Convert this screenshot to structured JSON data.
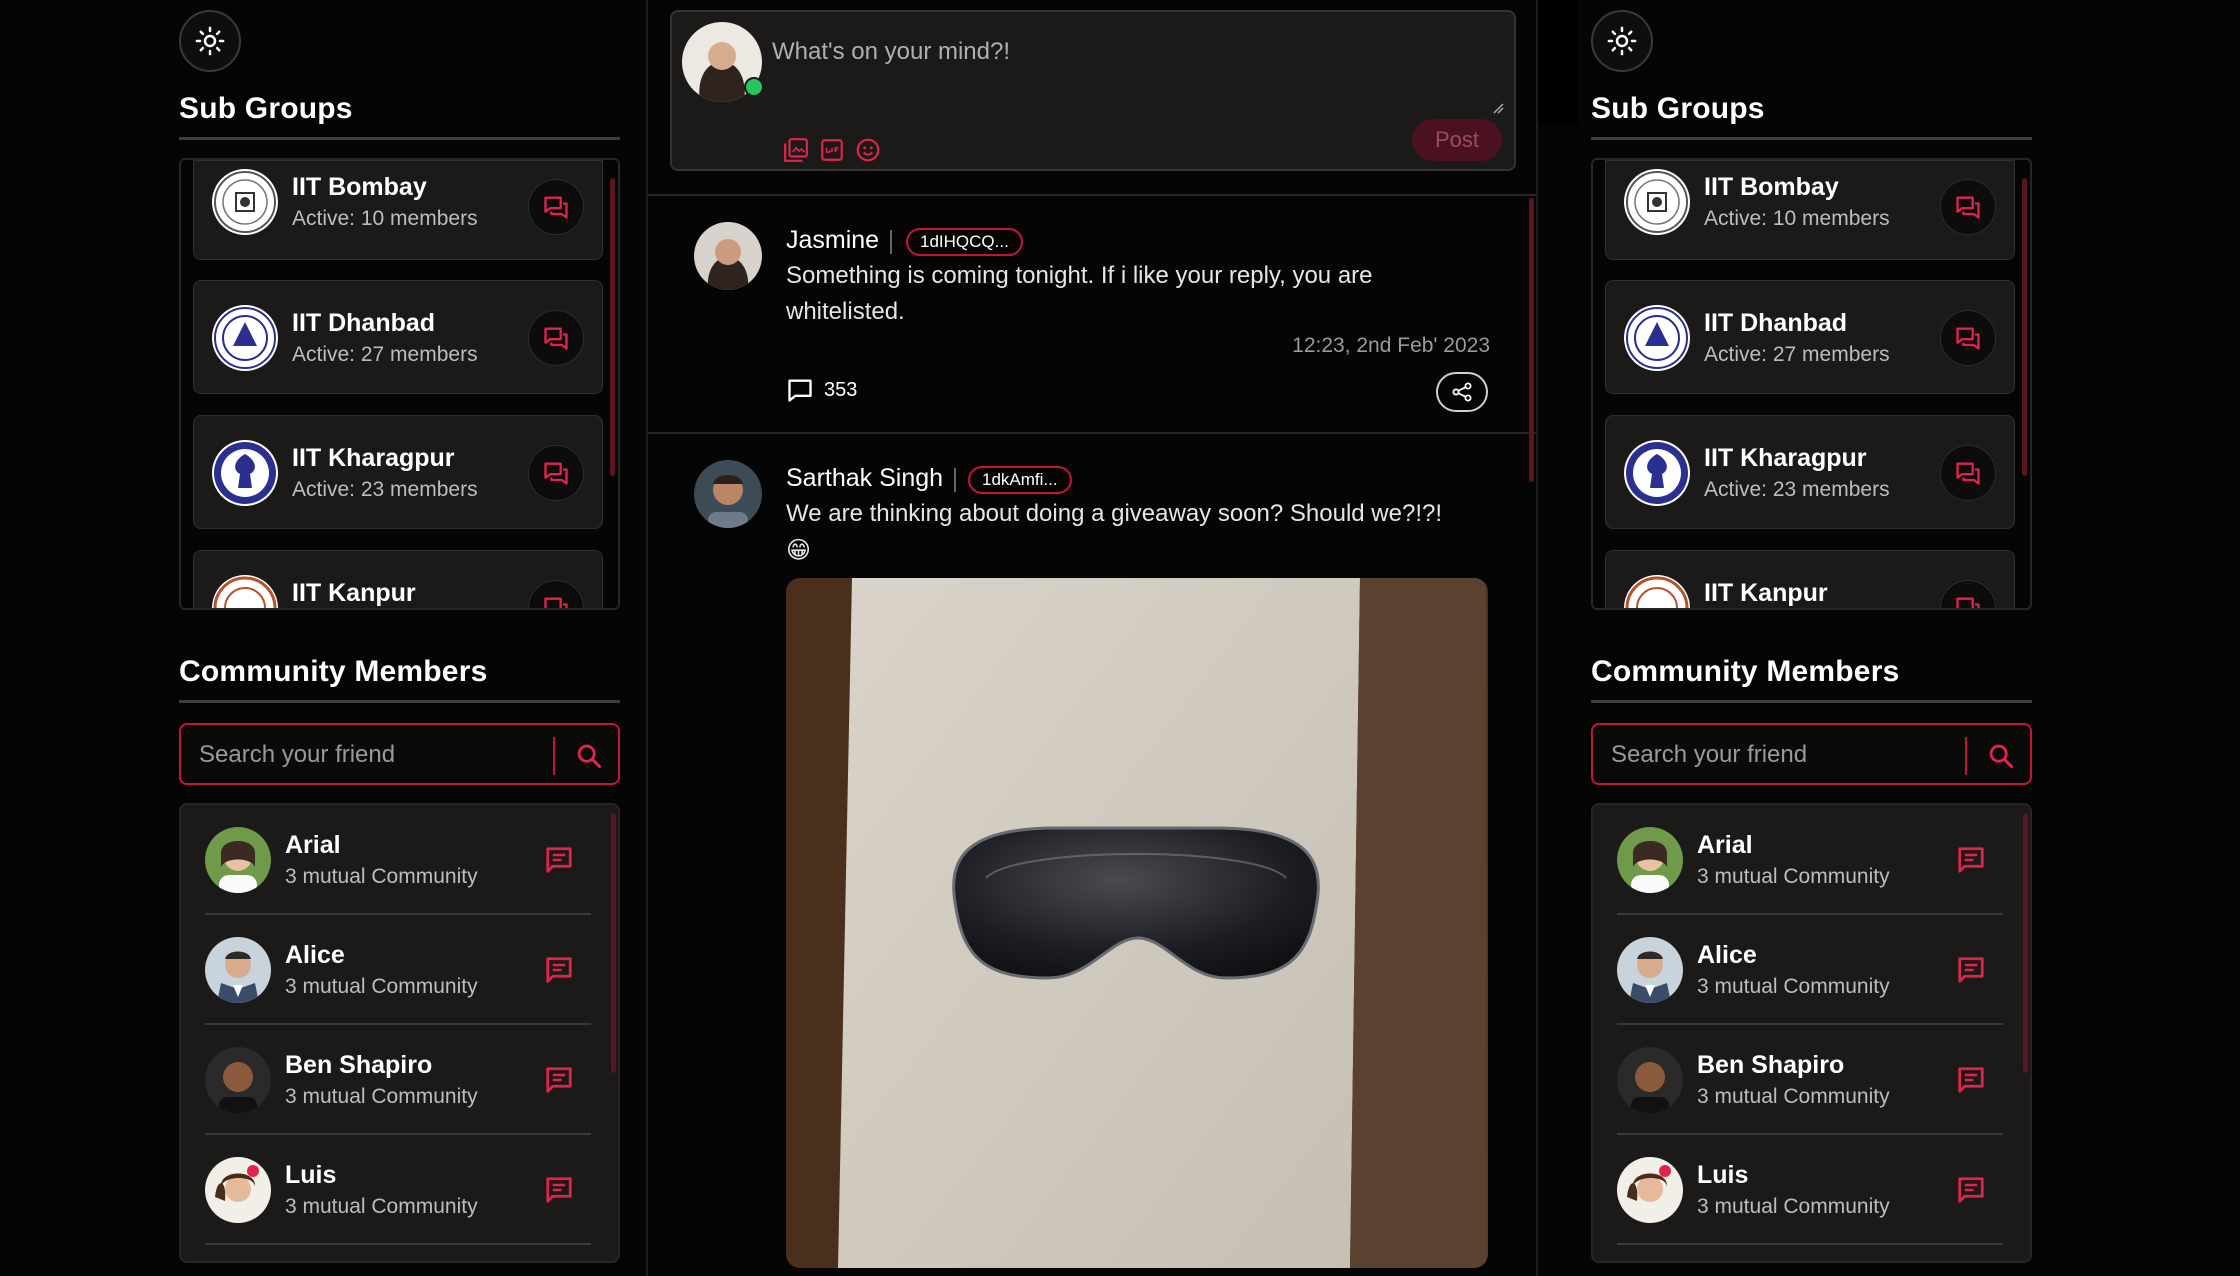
{
  "sidebar": {
    "sub_groups_title": "Sub Groups",
    "community_title": "Community Members",
    "search_placeholder": "Search your friend",
    "groups": [
      {
        "name": "IIT Bombay",
        "active": "Active: 10 members"
      },
      {
        "name": "IIT Dhanbad",
        "active": "Active: 27 members"
      },
      {
        "name": "IIT Kharagpur",
        "active": "Active: 23 members"
      },
      {
        "name": "IIT Kanpur",
        "active": ""
      }
    ],
    "members": [
      {
        "name": "Arial",
        "mutual": "3 mutual Community"
      },
      {
        "name": "Alice",
        "mutual": "3 mutual Community"
      },
      {
        "name": "Ben Shapiro",
        "mutual": "3 mutual Community"
      },
      {
        "name": "Luis",
        "mutual": "3 mutual Community"
      }
    ]
  },
  "composer": {
    "placeholder": "What's on your mind?!",
    "post_label": "Post"
  },
  "posts": [
    {
      "author": "Jasmine",
      "tag": "1dIHQCQ...",
      "text": "Something is coming tonight. If i like your reply, you are whitelisted.",
      "time": "12:23, 2nd Feb' 2023",
      "comments": "353"
    },
    {
      "author": "Sarthak Singh",
      "tag": "1dkAmfi...",
      "text": "We are thinking about doing a giveaway soon? Should we?!?!",
      "emoji": "😁"
    }
  ],
  "colors": {
    "accent": "#c4163a",
    "background": "#050505",
    "card": "#1c1a18",
    "online": "#22c55e"
  }
}
